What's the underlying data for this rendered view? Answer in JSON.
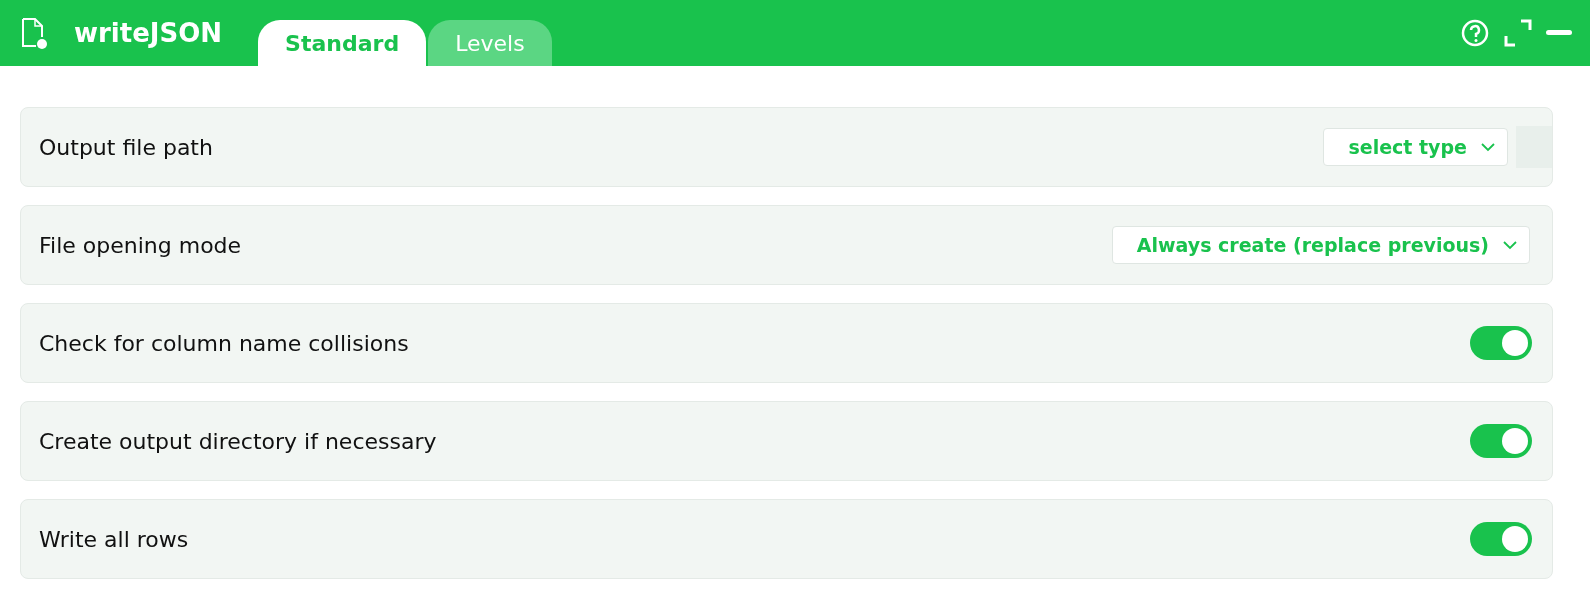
{
  "app": {
    "title": "writeJSON"
  },
  "tabs": [
    {
      "label": "Standard",
      "selected": true
    },
    {
      "label": "Levels",
      "selected": false
    }
  ],
  "settings": [
    {
      "kind": "path",
      "label": "Output file path",
      "value": "select type"
    },
    {
      "kind": "select",
      "label": "File opening mode",
      "value": "Always create (replace previous)"
    },
    {
      "kind": "toggle",
      "label": "Check for column name collisions",
      "on": true
    },
    {
      "kind": "toggle",
      "label": "Create output directory if necessary",
      "on": true
    },
    {
      "kind": "toggle",
      "label": "Write all rows",
      "on": true
    }
  ]
}
